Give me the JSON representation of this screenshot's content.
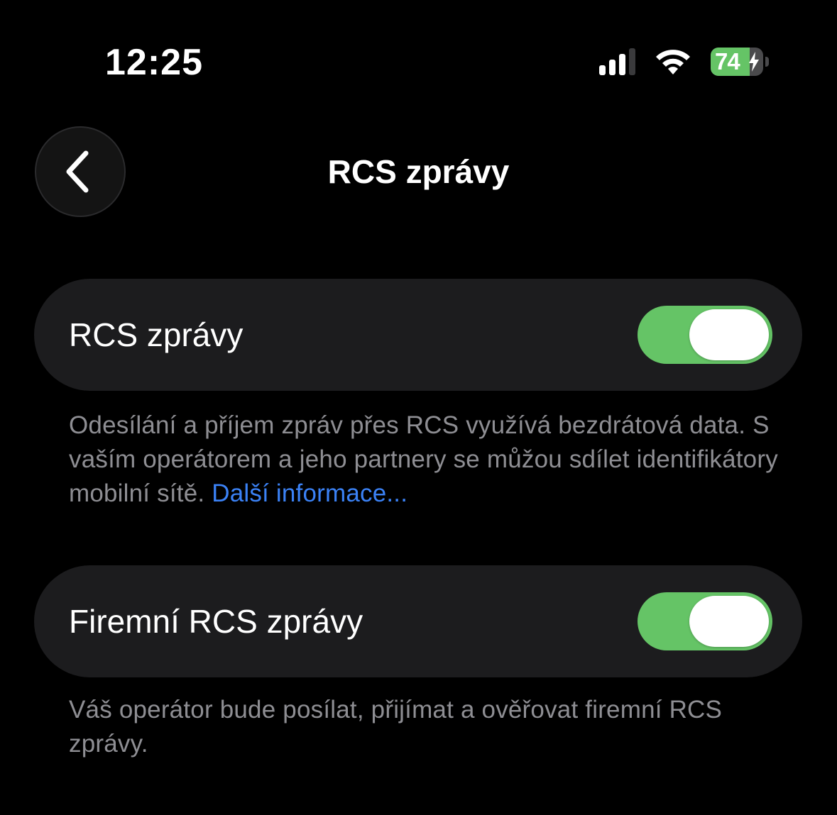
{
  "status_bar": {
    "time": "12:25",
    "battery_level": "74",
    "battery_fraction": 0.74,
    "signal_bars_active": 3,
    "signal_bars_total": 4,
    "icons": [
      "cellular-signal-icon",
      "wifi-icon",
      "battery-charging-icon"
    ]
  },
  "nav": {
    "title": "RCS zprávy",
    "back_icon": "chevron-left-icon"
  },
  "settings": [
    {
      "label": "RCS zprávy",
      "enabled": true,
      "footnote": "Odesílání a příjem zpráv přes RCS využívá bezdrátová data. S vaším operátorem a jeho partnery se můžou sdílet identifikátory mobilní sítě. ",
      "footnote_link": "Další informace..."
    },
    {
      "label": "Firemní RCS zprávy",
      "enabled": true,
      "footnote": "Váš operátor bude posílat, přijímat a ověřovat firemní RCS zprávy."
    }
  ],
  "colors": {
    "background": "#000000",
    "card": "#1c1c1e",
    "toggle_on": "#65c466",
    "footnote_text": "#8e8e93",
    "link": "#3b82f6",
    "battery_fill": "#65c466"
  }
}
